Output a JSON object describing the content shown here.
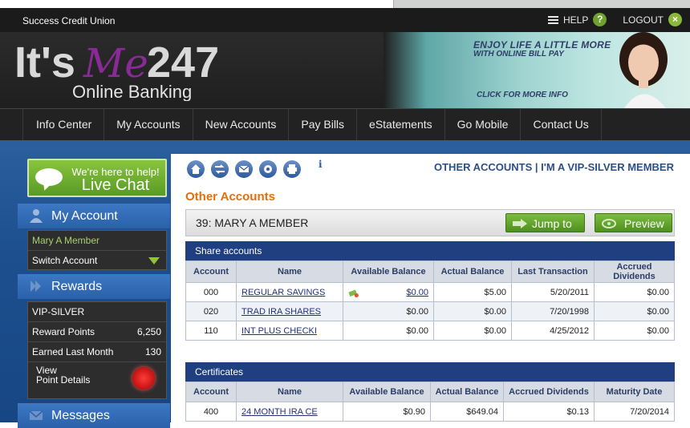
{
  "top_bar": {
    "credit_union": "Success Credit Union",
    "help": "HELP",
    "help_icon": "?",
    "logout": "LOGOUT",
    "logout_icon": "×"
  },
  "header": {
    "logo_its": "It's",
    "logo_me": "Me",
    "logo_247": "247",
    "logo_sub": "Online Banking",
    "banner_line1": "ENJOY LIFE A LITTLE MORE",
    "banner_line2": "WITH ONLINE BILL PAY",
    "banner_cta": "CLICK FOR MORE INFO"
  },
  "nav": {
    "items": [
      "Info Center",
      "My Accounts",
      "New Accounts",
      "Pay Bills",
      "eStatements",
      "Go Mobile",
      "Contact Us"
    ]
  },
  "sidebar": {
    "live_chat_line1": "We're here to help!",
    "live_chat_line2": "Live Chat",
    "my_account": {
      "label": "My Account",
      "member_name": "Mary A Member",
      "switch_account": "Switch Account"
    },
    "rewards": {
      "label": "Rewards",
      "tier": "VIP-SILVER",
      "reward_points_label": "Reward Points",
      "reward_points_value": "6,250",
      "earned_label": "Earned Last Month",
      "earned_value": "130",
      "view_line1": "View",
      "view_line2": "Point Details"
    },
    "messages": {
      "label": "Messages"
    }
  },
  "main": {
    "info_icon": "i",
    "header_right": "OTHER ACCOUNTS | I'M A VIP-SILVER MEMBER",
    "title": "Other Accounts",
    "member_line": "39: MARY A MEMBER",
    "jump_to": "Jump to",
    "preview": "Preview",
    "share_accounts": {
      "caption": "Share accounts",
      "columns": [
        "Account",
        "Name",
        "Available Balance",
        "Actual Balance",
        "Last Transaction",
        "Accrued Dividends"
      ],
      "rows": [
        {
          "account": "000",
          "name": "REGULAR SAVINGS",
          "available": "$0.00",
          "actual": "$5.00",
          "last": "5/20/2011",
          "accrued": "$0.00"
        },
        {
          "account": "020",
          "name": "TRAD IRA SHARES",
          "available": "$0.00",
          "actual": "$0.00",
          "last": "7/20/1998",
          "accrued": "$0.00"
        },
        {
          "account": "110",
          "name": "INT PLUS CHECKI",
          "available": "$0.00",
          "actual": "$0.00",
          "last": "4/25/2012",
          "accrued": "$0.00"
        }
      ]
    },
    "certificates": {
      "caption": "Certificates",
      "columns": [
        "Account",
        "Name",
        "Available Balance",
        "Actual Balance",
        "Accrued Dividends",
        "Maturity Date"
      ],
      "rows": [
        {
          "account": "400",
          "name": "24 MONTH IRA CE",
          "available": "$0.90",
          "actual": "$649.04",
          "accrued": "$0.13",
          "maturity": "7/20/2014"
        }
      ]
    }
  },
  "colors": {
    "accent_orange": "#e36f0c",
    "nav_blue": "#2d4f86",
    "chat_green": "#6ea12e",
    "table_header_blue": "#1f3f80"
  },
  "icons": [
    "menu-icon",
    "help-icon",
    "logout-icon",
    "home-icon",
    "transfer-icon",
    "mail-icon",
    "settings-icon",
    "print-icon",
    "info-icon",
    "chat-bubble-icon",
    "user-icon",
    "rewards-icon",
    "mail-sidebar-icon",
    "dropdown-triangle-icon",
    "arrow-right-icon",
    "eye-icon",
    "money-icon"
  ]
}
